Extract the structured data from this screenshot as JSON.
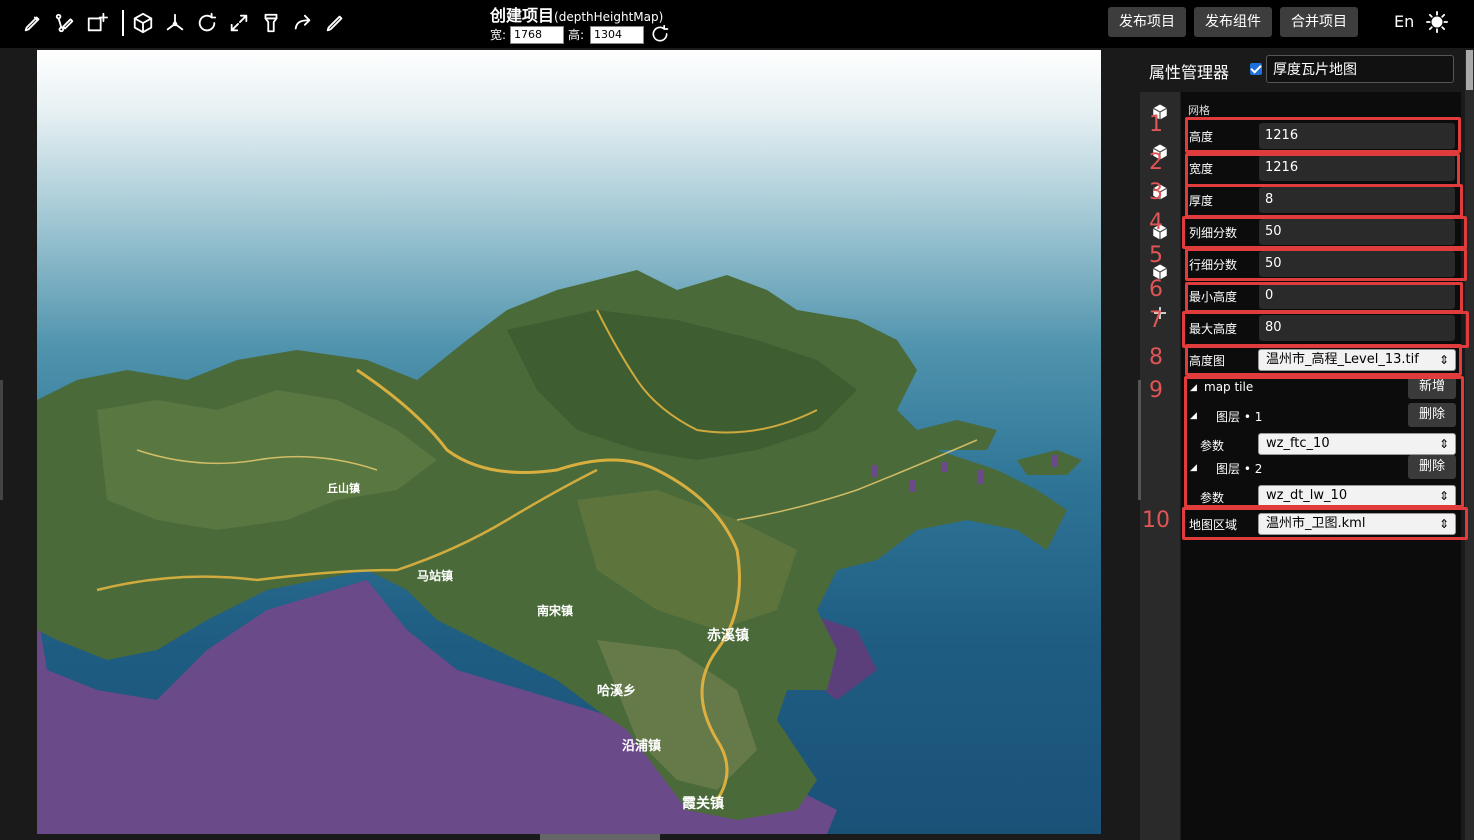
{
  "toolbar": {
    "tools": [
      "pencil-icon",
      "node-edit-icon",
      "add-frame-icon",
      "cube-icon",
      "axes-icon",
      "rotate-icon",
      "scale-icon",
      "flashlight-icon",
      "redo-arrow-icon",
      "edit-pen-icon"
    ]
  },
  "project": {
    "title": "创建项目",
    "subtitle": "(depthHeightMap)",
    "width_label": "宽:",
    "width_value": "1768",
    "height_label": "高:",
    "height_value": "1304"
  },
  "actions": {
    "publish_project": "发布项目",
    "publish_component": "发布组件",
    "merge_project": "合并项目",
    "language": "En"
  },
  "panel": {
    "title": "属性管理器",
    "object_name": "厚度瓦片地图",
    "checked": true
  },
  "properties": {
    "group": "网格",
    "height_label": "高度",
    "height_value": "1216",
    "width_label": "宽度",
    "width_value": "1216",
    "thickness_label": "厚度",
    "thickness_value": "8",
    "col_div_label": "列细分数",
    "col_div_value": "50",
    "row_div_label": "行细分数",
    "row_div_value": "50",
    "min_height_label": "最小高度",
    "min_height_value": "0",
    "max_height_label": "最大高度",
    "max_height_value": "80",
    "heightmap_label": "高度图",
    "heightmap_value": "温州市_高程_Level_13.tif",
    "map_tile_label": "map tile",
    "add_label": "新增",
    "layer1_label": "图层 • 1",
    "layer1_delete": "删除",
    "param_label": "参数",
    "layer1_param": "wz_ftc_10",
    "layer2_label": "图层 • 2",
    "layer2_delete": "删除",
    "layer2_param": "wz_dt_lw_10",
    "region_label": "地图区域",
    "region_value": "温州市_卫图.kml"
  },
  "markers": [
    "1",
    "2",
    "3",
    "4",
    "5",
    "6",
    "7",
    "8",
    "9",
    "10"
  ],
  "map_labels": [
    "赤溪镇",
    "霞关镇",
    "沿浦镇",
    "哈溪乡",
    "马站镇",
    "南宋镇",
    "丘山镇"
  ],
  "colors": {
    "accent_red": "#e03c3c",
    "checkbox_blue": "#1e6fd9",
    "sea": "#2a6b90",
    "terrain": "#4a6a3a",
    "terrain_side": "#6b4a8a",
    "roads": "#e8b640"
  }
}
